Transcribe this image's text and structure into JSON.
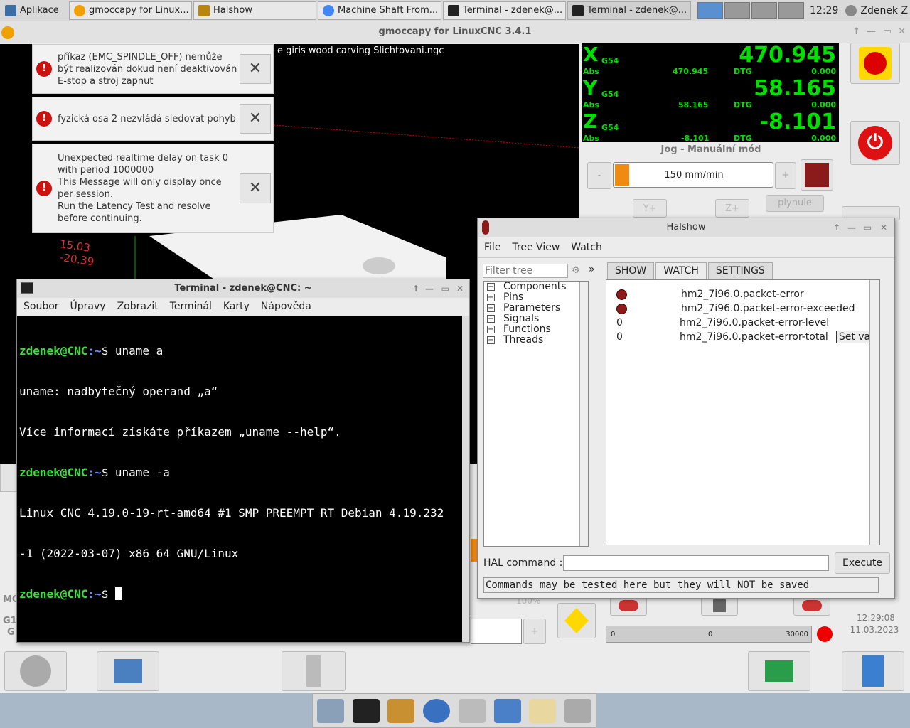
{
  "taskbar": {
    "apps_label": "Aplikace",
    "tasks": [
      "gmoccapy for Linux...",
      "Halshow",
      "Machine Shaft From...",
      "Terminal - zdenek@...",
      "Terminal - zdenek@..."
    ],
    "clock": "12:29",
    "user": "Zdenek Z"
  },
  "gmoccapy": {
    "title": "gmoccapy for LinuxCNC  3.4.1",
    "file_label": "e giris wood carving Slichtovani.ngc",
    "plot_labels": [
      "15.03",
      "-20.39"
    ],
    "dro": {
      "x": {
        "axis": "X",
        "coord": "G54",
        "value": "470.945",
        "abs_label": "Abs",
        "abs": "470.945",
        "dtg_label": "DTG",
        "dtg": "0.000"
      },
      "y": {
        "axis": "Y",
        "coord": "G54",
        "value": "58.165",
        "abs_label": "Abs",
        "abs": "58.165",
        "dtg_label": "DTG",
        "dtg": "0.000"
      },
      "z": {
        "axis": "Z",
        "coord": "G54",
        "value": "-8.101",
        "abs_label": "Abs",
        "abs": "-8.101",
        "dtg_label": "DTG",
        "dtg": "0.000"
      }
    },
    "jog": {
      "title": "Jog - Manuální mód",
      "minus": "-",
      "plus": "+",
      "speed": "150 mm/min",
      "continuous": "plynule",
      "y_plus": "Y+",
      "z_plus": "Z+"
    },
    "spindle_bar": {
      "min": "0",
      "value": "0",
      "max": "30000"
    },
    "override_label": "100%",
    "date": "12:29:08",
    "date2": "11.03.2023",
    "side_labels": [
      "MO",
      "G1",
      "G"
    ]
  },
  "notifications": [
    {
      "text": "příkaz (EMC_SPINDLE_OFF) nemůže být realizován dokud není deaktivován E-stop a stroj zapnut"
    },
    {
      "text": "fyzická osa 2 nezvládá sledovat pohyb"
    },
    {
      "text": "Unexpected realtime delay on task 0 with period 1000000\nThis Message will only display once per session.\nRun the Latency Test and resolve before continuing."
    }
  ],
  "terminal": {
    "title": "Terminal - zdenek@CNC: ~",
    "menu": [
      "Soubor",
      "Úpravy",
      "Zobrazit",
      "Terminál",
      "Karty",
      "Nápověda"
    ],
    "prompt_user": "zdenek@CNC",
    "prompt_path": ":~",
    "lines": [
      {
        "cmd": "$ uname a"
      },
      {
        "out": "uname: nadbytečný operand „a“"
      },
      {
        "out": "Více informací získáte příkazem „uname --help“."
      },
      {
        "cmd": "$ uname -a"
      },
      {
        "out": "Linux CNC 4.19.0-19-rt-amd64 #1 SMP PREEMPT RT Debian 4.19.232"
      },
      {
        "out": "-1 (2022-03-07) x86_64 GNU/Linux"
      },
      {
        "cmd": "$ "
      }
    ]
  },
  "halshow": {
    "title": "Halshow",
    "menu": [
      "File",
      "Tree View",
      "Watch"
    ],
    "filter_placeholder": "Filter tree",
    "more": "»",
    "tree": [
      "Components",
      "Pins",
      "Parameters",
      "Signals",
      "Functions",
      "Threads"
    ],
    "tabs": [
      "SHOW",
      "WATCH",
      "SETTINGS"
    ],
    "watch": [
      {
        "type": "led",
        "name": "hm2_7i96.0.packet-error"
      },
      {
        "type": "led",
        "name": "hm2_7i96.0.packet-error-exceeded"
      },
      {
        "type": "num",
        "value": "0",
        "name": "hm2_7i96.0.packet-error-level"
      },
      {
        "type": "num",
        "value": "0",
        "name": "hm2_7i96.0.packet-error-total",
        "button": "Set val"
      }
    ],
    "hal_label": "HAL command :",
    "execute": "Execute",
    "status": "Commands may be tested here but they will NOT be saved"
  }
}
